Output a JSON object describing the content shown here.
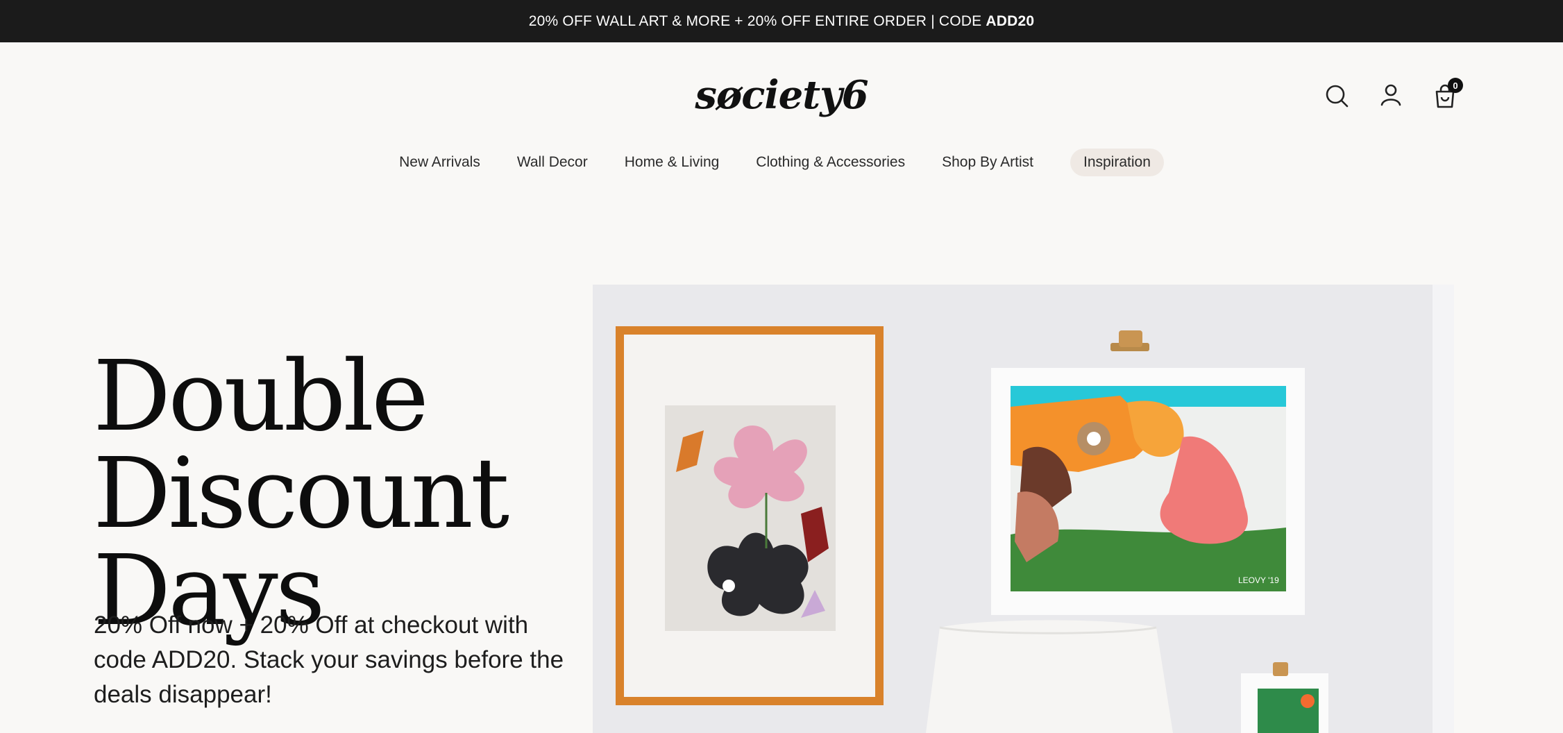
{
  "promo": {
    "text": "20% OFF WALL ART & MORE + 20% OFF ENTIRE ORDER | CODE",
    "code": "ADD20"
  },
  "header": {
    "logo": "søciety6",
    "icons": [
      "search-icon",
      "account-icon",
      "cart-icon"
    ],
    "cart_count": "0"
  },
  "nav": {
    "items": [
      {
        "label": "New Arrivals"
      },
      {
        "label": "Wall Decor"
      },
      {
        "label": "Home & Living"
      },
      {
        "label": "Clothing & Accessories"
      },
      {
        "label": "Shop By Artist"
      },
      {
        "label": "Inspiration"
      }
    ]
  },
  "hero": {
    "title_lines": [
      "Double",
      "Discount",
      "Days"
    ],
    "subtitle": "20% Off now + 20% Off at checkout with code ADD20. Stack your savings before the deals disappear!",
    "image_signature": "LEOVY '19"
  },
  "colors": {
    "promo_bg": "#1b1b1b",
    "page_bg": "#f9f8f6",
    "pill_bg": "#efe9e4",
    "frame": "#d9822b"
  }
}
